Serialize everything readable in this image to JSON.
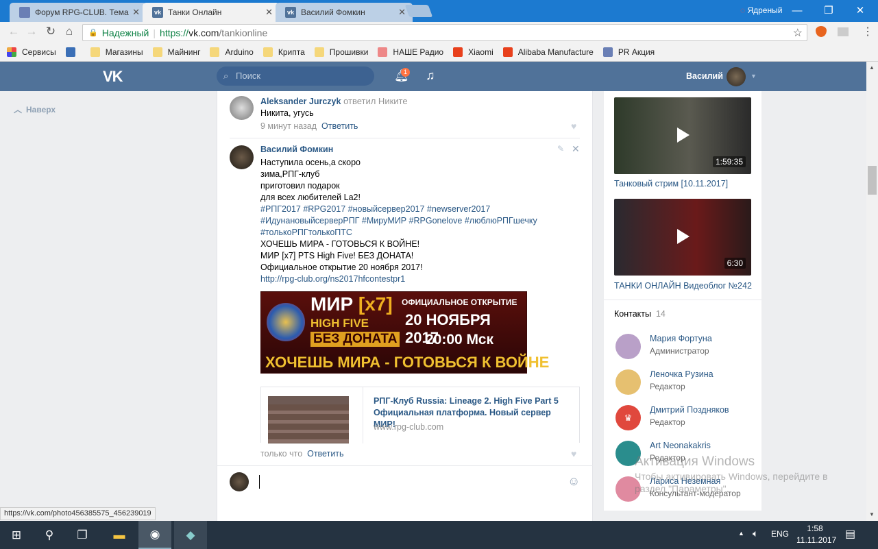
{
  "browser": {
    "tabs": [
      {
        "title": "Форум RPG-CLUB. Тема",
        "active": false
      },
      {
        "title": "Танки Онлайн",
        "active": true
      },
      {
        "title": "Василий Фомкин",
        "active": false
      }
    ],
    "profile_name": "Ядреный",
    "security_label": "Надежный",
    "url_scheme": "https://",
    "url_host": "vk.com",
    "url_path": "/tankionline",
    "bookmarks": [
      "Сервисы",
      "Магазины",
      "Майнинг",
      "Arduino",
      "Крипта",
      "Прошивки",
      "НАШЕ Радио",
      "Xiaomi",
      "Alibaba Manufacture",
      "PR Акция"
    ],
    "status_url": "https://vk.com/photo456385575_456239019"
  },
  "vk": {
    "search_placeholder": "Поиск",
    "notifications_count": "1",
    "user_name": "Василий",
    "back_to_top": "Наверх"
  },
  "comments": [
    {
      "author": "Aleksander Jurczyk",
      "reply_to": "ответил Никите",
      "text": "Никита, угусь",
      "time": "9 минут назад",
      "reply": "Ответить"
    },
    {
      "author": "Василий Фомкин",
      "lines": [
        "Наступила осень,а скоро",
        "зима,РПГ-клуб",
        "приготовил подарок",
        "для всех любителей La2!"
      ],
      "hashtags": [
        "#РПГ2017 #RPG2017 #новыйсервер2017 #newserver2017",
        "#ИдунановыйсерверРПГ #МируМИР #RPGonelove #люблюРПГшечку",
        "#толькоРПГтолькоПТС"
      ],
      "lines2": [
        "ХОЧЕШЬ МИРА - ГОТОВЬСЯ К ВОЙНЕ!",
        "МИР [x7] PTS High Five! БЕЗ ДОНАТА!",
        "Официальное открытие 20 ноября 2017!"
      ],
      "link": "http://rpg-club.org/ns2017hfcontestpr1",
      "banner": {
        "l1": "МИР",
        "l2": "[x7]",
        "l3": "HIGH FIVE",
        "l4": "БЕЗ ДОНАТА",
        "r1": "ОФИЦИАЛЬНОЕ ОТКРЫТИЕ",
        "r2": "20 НОЯБРЯ 2017",
        "r3": "20:00 Мск",
        "bottom": "ХОЧЕШЬ МИРА - ГОТОВЬСЯ К ВОЙНЕ"
      },
      "card": {
        "title": "РПГ-Клуб Russia: Lineage 2. High Five Part 5 Официальная платформа. Новый сервер МИР!",
        "domain": "www.rpg-club.com"
      },
      "time": "только что",
      "reply": "Ответить"
    }
  ],
  "videos": [
    {
      "title": "Танковый стрим [10.11.2017]",
      "duration": "1:59:35"
    },
    {
      "title": "ТАНКИ ОНЛАЙН Видеоблог №242",
      "duration": "6:30"
    }
  ],
  "contacts": {
    "title": "Контакты",
    "count": "14",
    "items": [
      {
        "name": "Мария Фортуна",
        "role": "Администратор",
        "color": "#b9a0c8"
      },
      {
        "name": "Леночка Рузина",
        "role": "Редактор",
        "color": "#e6c070"
      },
      {
        "name": "Дмитрий Поздняков",
        "role": "Редактор",
        "color": "#e0483d"
      },
      {
        "name": "Art Neonakakris",
        "role": "Редактор",
        "color": "#2a8d8d"
      },
      {
        "name": "Лариса Неземная",
        "role": "Консультант-модератор",
        "color": "#e08aa0"
      }
    ]
  },
  "watermark": {
    "title": "Активация Windows",
    "text": "Чтобы активировать Windows, перейдите в раздел \"Параметры\"."
  },
  "taskbar": {
    "lang": "ENG",
    "time": "1:58",
    "date": "11.11.2017"
  }
}
